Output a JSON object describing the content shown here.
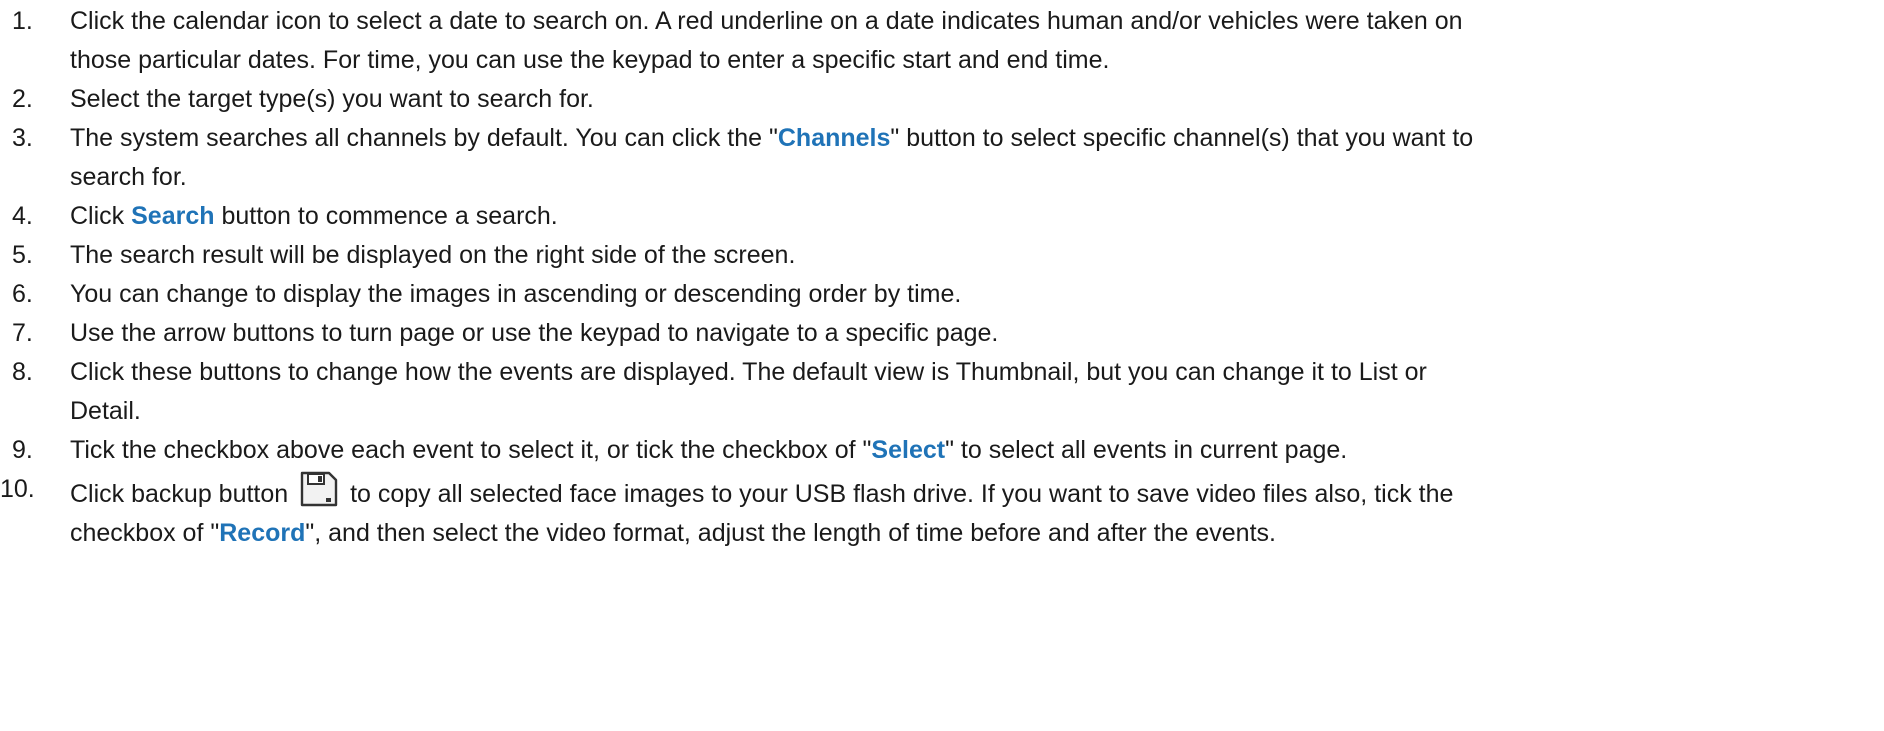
{
  "steps": [
    {
      "number": "1.",
      "line1": "Click the calendar icon to select a date to search on. A red underline on a date indicates human and/or vehicles were taken on",
      "line2": "those particular dates. For time, you can use the keypad to enter a specific start and end time."
    },
    {
      "number": "2.",
      "text": "Select the target type(s) you want to search for."
    },
    {
      "number": "3.",
      "pre": "The system searches all channels by default. You can click the \"",
      "keyword": "Channels",
      "post": "\" button to select specific channel(s) that you want to",
      "line2": "search for."
    },
    {
      "number": "4.",
      "pre": "Click ",
      "keyword": "Search",
      "post": " button to commence a search."
    },
    {
      "number": "5.",
      "text": "The search result will be displayed on the right side of the screen."
    },
    {
      "number": "6.",
      "text": "You can change to display the images in ascending or descending order by time."
    },
    {
      "number": "7.",
      "text": "Use the arrow buttons to turn page or use the keypad to navigate to a specific page."
    },
    {
      "number": "8.",
      "line1": "Click these buttons to change how the events are displayed. The default view is Thumbnail, but you can change it to List or",
      "line2": "Detail."
    },
    {
      "number": "9.",
      "pre": "Tick the checkbox above each event to select it, or tick the checkbox of \"",
      "keyword": "Select",
      "post": "\" to select all events in current page."
    },
    {
      "number": "10.",
      "pre": "Click backup button ",
      "icon": "backup-floppy-icon",
      "post": " to copy all selected face images to your USB flash drive. If you want to save video files also, tick the",
      "line2_pre": "checkbox of \"",
      "keyword": "Record",
      "line2_post": "\", and then select the video format, adjust the length of time before and after the events."
    }
  ],
  "colors": {
    "text": "#1a1a1a",
    "keyword": "#1f73b7",
    "icon_stroke": "#333333",
    "icon_fill": "#f2f2f2"
  }
}
